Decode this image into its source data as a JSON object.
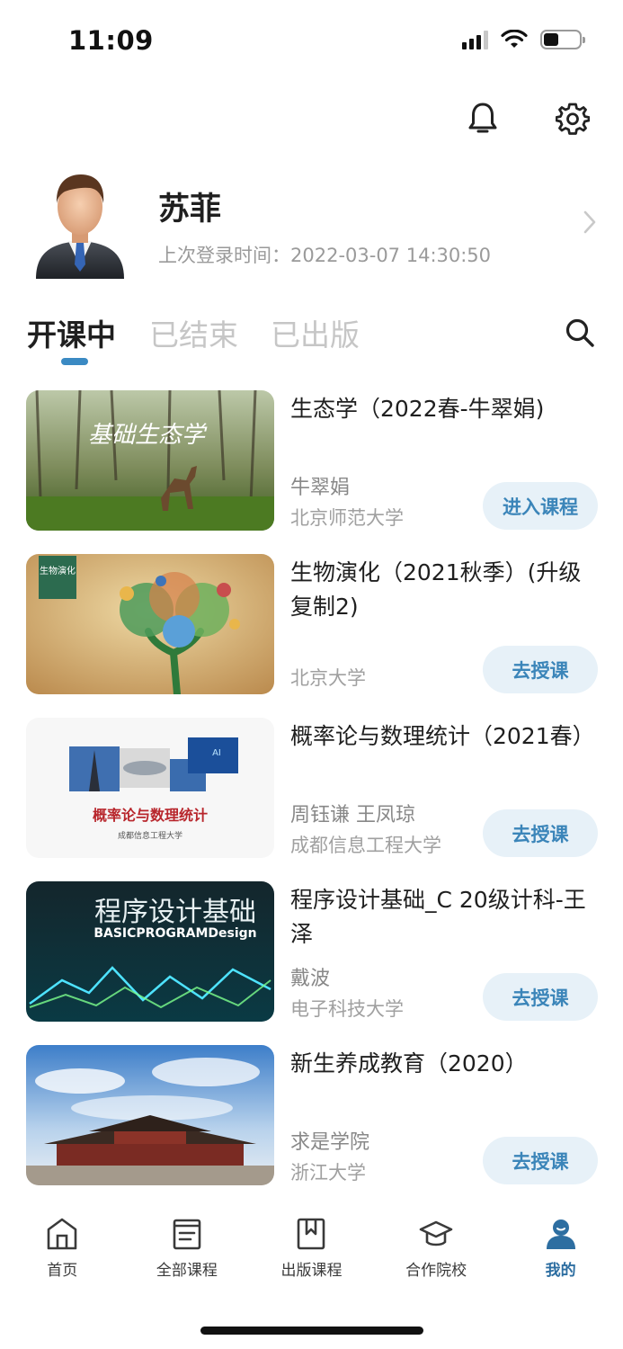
{
  "status_bar": {
    "time": "11:09"
  },
  "header": {
    "bell_icon": "bell-icon",
    "settings_icon": "gear-icon"
  },
  "profile": {
    "name": "苏菲",
    "last_login": "上次登录时间：2022-03-07 14:30:50"
  },
  "tabs": [
    {
      "label": "开课中",
      "active": true
    },
    {
      "label": "已结束",
      "active": false
    },
    {
      "label": "已出版",
      "active": false
    }
  ],
  "courses": [
    {
      "title": "生态学（2022春-牛翠娟)",
      "teacher": "牛翠娟",
      "school": "北京师范大学",
      "button": "进入课程",
      "cover_text": "基础生态学"
    },
    {
      "title": "生物演化（2021秋季）(升级复制2)",
      "teacher": "",
      "school": "北京大学",
      "button": "去授课",
      "cover_text": "生物演化"
    },
    {
      "title": "概率论与数理统计（2021春）",
      "teacher": "周钰谦 王凤琼",
      "school": "成都信息工程大学",
      "button": "去授课",
      "cover_text": "概率论与数理统计",
      "cover_subtext": "成都信息工程大学"
    },
    {
      "title": "程序设计基础_C 20级计科-王泽",
      "teacher": "戴波",
      "school": "电子科技大学",
      "button": "去授课",
      "cover_text": "程序设计基础",
      "cover_subtext": "BASICPROGRAMDesign"
    },
    {
      "title": "新生养成教育（2020）",
      "teacher": "求是学院",
      "school": "浙江大学",
      "button": "去授课",
      "cover_text": ""
    }
  ],
  "bottom_nav": [
    {
      "label": "首页",
      "icon": "home-icon",
      "active": false
    },
    {
      "label": "全部课程",
      "icon": "courses-icon",
      "active": false
    },
    {
      "label": "出版课程",
      "icon": "bookmark-book-icon",
      "active": false
    },
    {
      "label": "合作院校",
      "icon": "graduation-cap-icon",
      "active": false
    },
    {
      "label": "我的",
      "icon": "profile-icon",
      "active": true
    }
  ],
  "colors": {
    "accent": "#3b8ac3",
    "button_bg": "#e7f1f8",
    "button_text": "#3b85b9"
  }
}
